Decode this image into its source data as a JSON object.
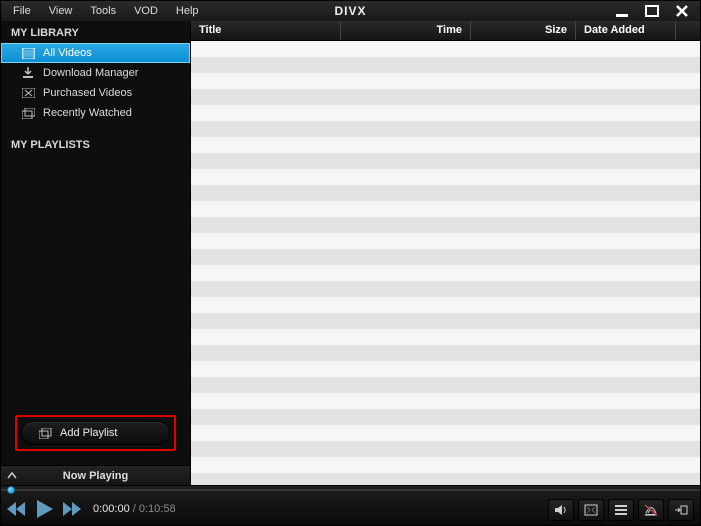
{
  "brand": "DIVX",
  "menu": [
    "File",
    "View",
    "Tools",
    "VOD",
    "Help"
  ],
  "sidebar": {
    "library_header": "MY LIBRARY",
    "playlist_header": "MY PLAYLISTS",
    "items": [
      {
        "label": "All Videos"
      },
      {
        "label": "Download Manager"
      },
      {
        "label": "Purchased Videos"
      },
      {
        "label": "Recently Watched"
      }
    ],
    "add_playlist_label": "Add Playlist",
    "now_playing_label": "Now Playing"
  },
  "columns": {
    "title": "Title",
    "time": "Time",
    "size": "Size",
    "date_added": "Date Added"
  },
  "player": {
    "elapsed": "0:00:00",
    "total": "0:10:58"
  }
}
